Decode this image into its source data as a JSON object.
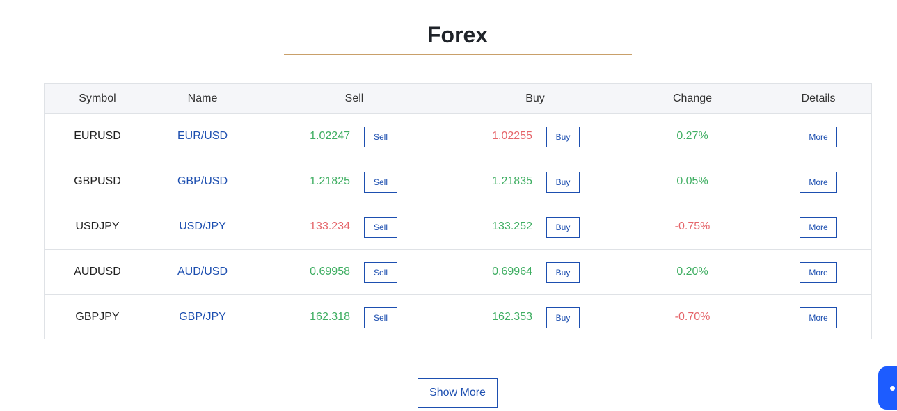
{
  "title": "Forex",
  "headers": {
    "symbol": "Symbol",
    "name": "Name",
    "sell": "Sell",
    "buy": "Buy",
    "change": "Change",
    "details": "Details"
  },
  "rows": [
    {
      "symbol": "EURUSD",
      "name": "EUR/USD",
      "sell": "1.02247",
      "sell_dir": "pos",
      "buy": "1.02255",
      "buy_dir": "neg",
      "change": "0.27%",
      "change_dir": "pos"
    },
    {
      "symbol": "GBPUSD",
      "name": "GBP/USD",
      "sell": "1.21825",
      "sell_dir": "pos",
      "buy": "1.21835",
      "buy_dir": "pos",
      "change": "0.05%",
      "change_dir": "pos"
    },
    {
      "symbol": "USDJPY",
      "name": "USD/JPY",
      "sell": "133.234",
      "sell_dir": "neg",
      "buy": "133.252",
      "buy_dir": "pos",
      "change": "-0.75%",
      "change_dir": "neg"
    },
    {
      "symbol": "AUDUSD",
      "name": "AUD/USD",
      "sell": "0.69958",
      "sell_dir": "pos",
      "buy": "0.69964",
      "buy_dir": "pos",
      "change": "0.20%",
      "change_dir": "pos"
    },
    {
      "symbol": "GBPJPY",
      "name": "GBP/JPY",
      "sell": "162.318",
      "sell_dir": "pos",
      "buy": "162.353",
      "buy_dir": "pos",
      "change": "-0.70%",
      "change_dir": "neg"
    }
  ],
  "buttons": {
    "sell": "Sell",
    "buy": "Buy",
    "more": "More",
    "show_more": "Show More"
  },
  "colors": {
    "positive": "#3fae62",
    "negative": "#e5656a",
    "accent": "#1d4fb0",
    "underline": "#c9a06a",
    "chat_widget": "#1d5cff"
  }
}
